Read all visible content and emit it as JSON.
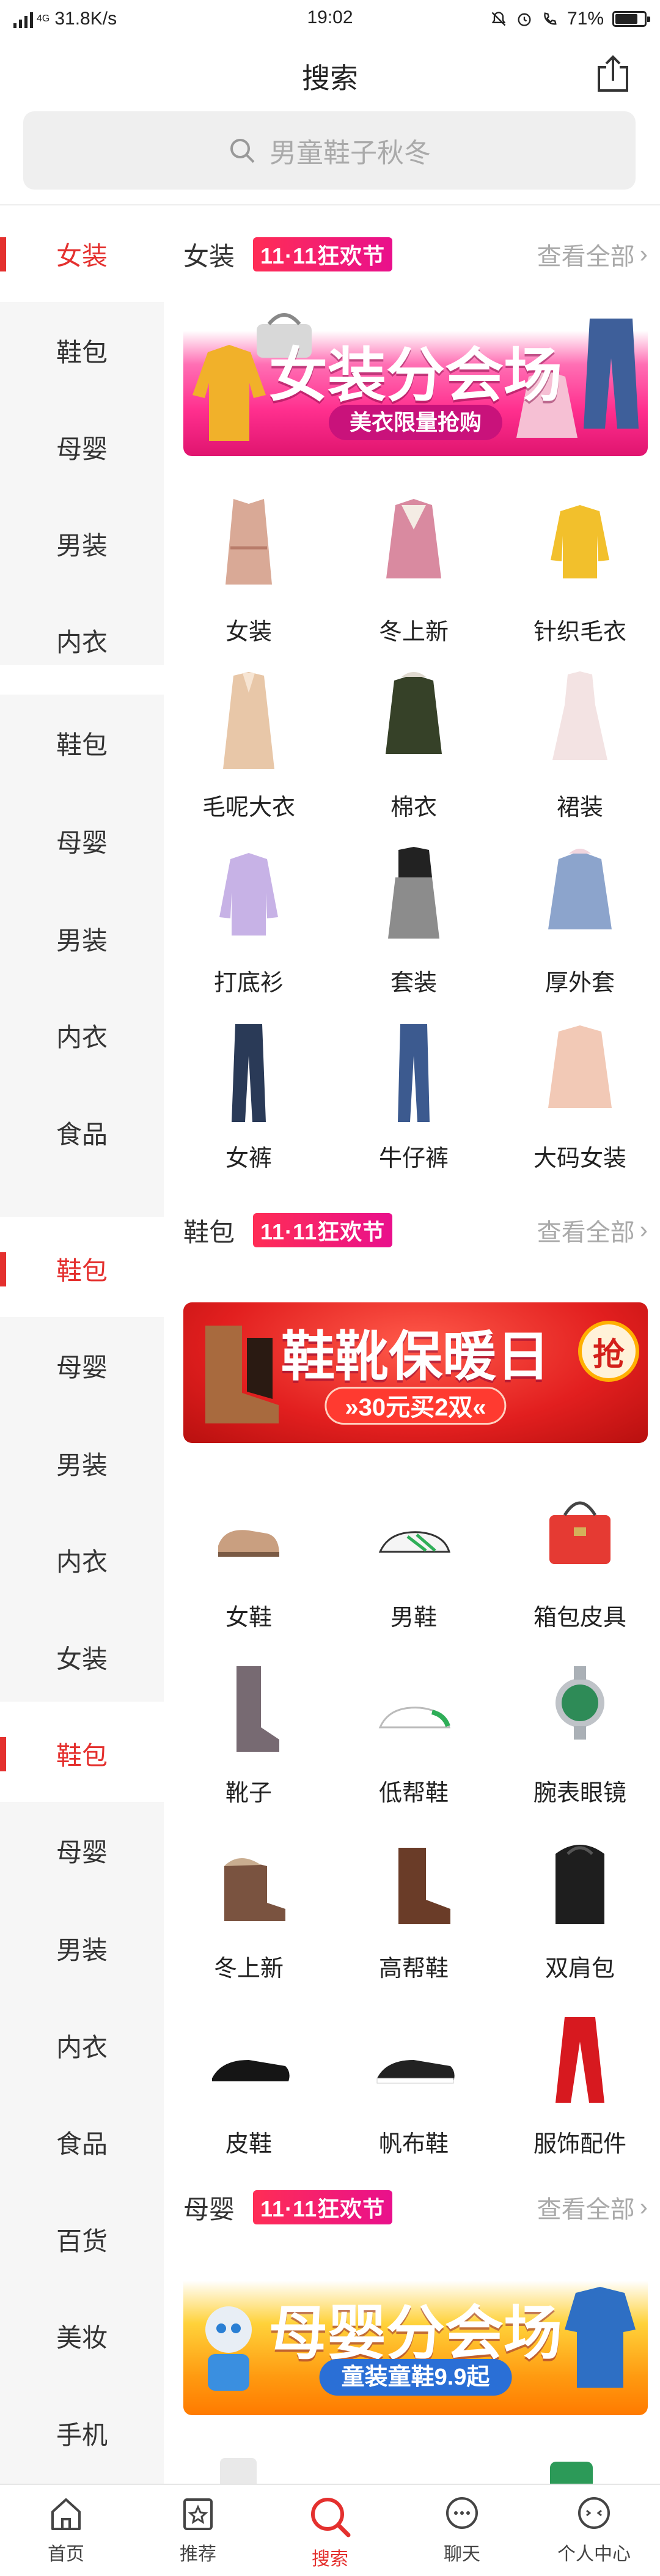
{
  "status_bar": {
    "network": "4G",
    "speed": "31.8K/s",
    "time": "19:02",
    "battery": "71%",
    "battery_level": 0.71
  },
  "header": {
    "title": "搜索"
  },
  "search": {
    "placeholder": "男童鞋子秋冬"
  },
  "sidebar": {
    "items": [
      "女装",
      "鞋包",
      "母婴",
      "男装",
      "内衣",
      "鞋包",
      "母婴",
      "男装",
      "内衣",
      "食品",
      "鞋包",
      "母婴",
      "男装",
      "内衣",
      "女装",
      "鞋包",
      "母婴",
      "男装",
      "内衣",
      "食品",
      "百货",
      "美妆",
      "手机"
    ]
  },
  "sections": [
    {
      "name": "女装",
      "badge": "11·11狂欢节",
      "more": "查看全部",
      "banner": {
        "title": "女装分会场",
        "subtitle": "美衣限量抢购"
      },
      "items": [
        "女装",
        "冬上新",
        "针织毛衣",
        "毛呢大衣",
        "棉衣",
        "裙装",
        "打底衫",
        "套装",
        "厚外套",
        "女裤",
        "牛仔裤",
        "大码女装"
      ]
    },
    {
      "name": "鞋包",
      "badge": "11·11狂欢节",
      "more": "查看全部",
      "banner": {
        "title": "鞋靴保暖日",
        "subtitle": "»30元买2双«",
        "badge": "抢"
      },
      "items": [
        "女鞋",
        "男鞋",
        "箱包皮具",
        "靴子",
        "低帮鞋",
        "腕表眼镜",
        "冬上新",
        "高帮鞋",
        "双肩包",
        "皮鞋",
        "帆布鞋",
        "服饰配件"
      ]
    },
    {
      "name": "母婴",
      "badge": "11·11狂欢节",
      "more": "查看全部",
      "banner": {
        "title": "母婴分会场",
        "subtitle": "童装童鞋9.9起"
      }
    }
  ],
  "tabbar": {
    "items": [
      {
        "label": "首页",
        "icon": "home-icon"
      },
      {
        "label": "推荐",
        "icon": "star-icon"
      },
      {
        "label": "搜索",
        "icon": "search-icon"
      },
      {
        "label": "聊天",
        "icon": "chat-icon"
      },
      {
        "label": "个人中心",
        "icon": "profile-icon"
      }
    ]
  },
  "colors": {
    "accent": "#e4302e",
    "badge": "#ff2d55"
  }
}
